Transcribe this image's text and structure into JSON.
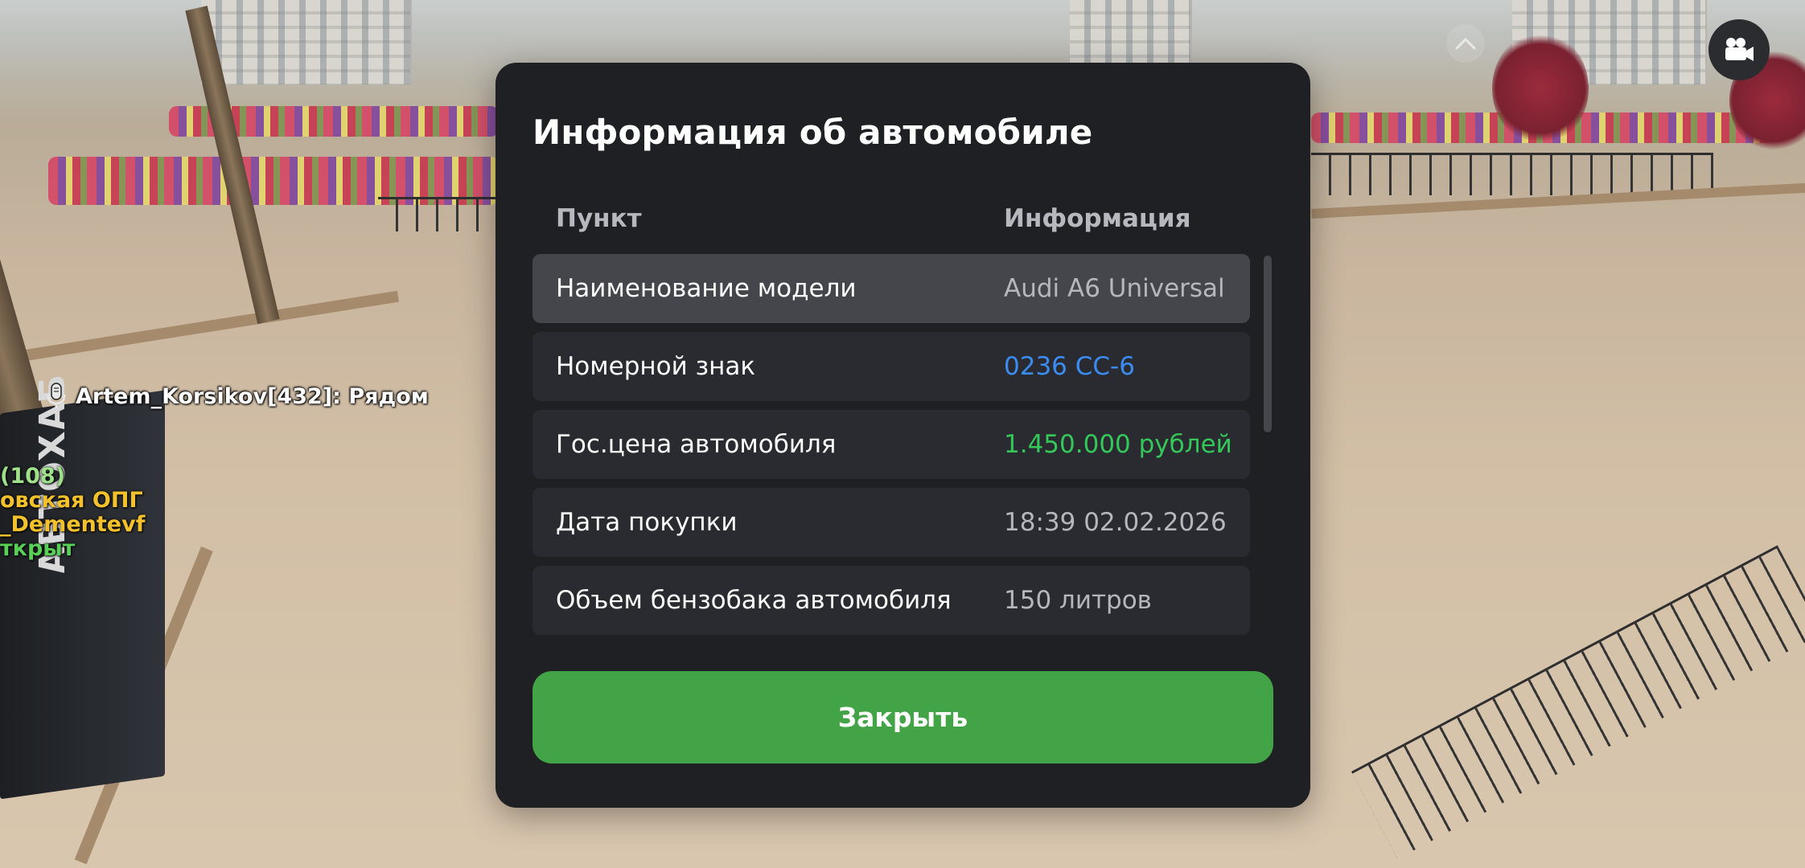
{
  "hud": {
    "nametag": "Artem_Korsikov[432]: Рядом",
    "side_lines": [
      "(108)",
      "овская ОПГ",
      "_Dementevf",
      "ткрыт"
    ]
  },
  "kiosk_brand": "АВТОХАБ",
  "dialog": {
    "title": "Информация об автомобиле",
    "columns": [
      "Пункт",
      "Информация"
    ],
    "rows": [
      {
        "label": "Наименование модели",
        "value": "Audi A6 Universal"
      },
      {
        "label": "Номерной знак",
        "value": "0236 CC-6"
      },
      {
        "label": "Гос.цена автомобиля",
        "value": "1.450.000 рублей"
      },
      {
        "label": "Дата покупки",
        "value": "18:39 02.02.2026"
      },
      {
        "label": "Объем бензобака автомобиля",
        "value": "150 литров"
      }
    ],
    "close_label": "Закрыть"
  },
  "colors": {
    "panel": "#1f2024",
    "row": "#2a2b30",
    "row_selected": "#45464c",
    "plate": "#3b8cf0",
    "price": "#34c85a",
    "close": "#42a347"
  },
  "icons": [
    "microphone-icon",
    "video-camera-icon",
    "chevron-up-icon"
  ]
}
